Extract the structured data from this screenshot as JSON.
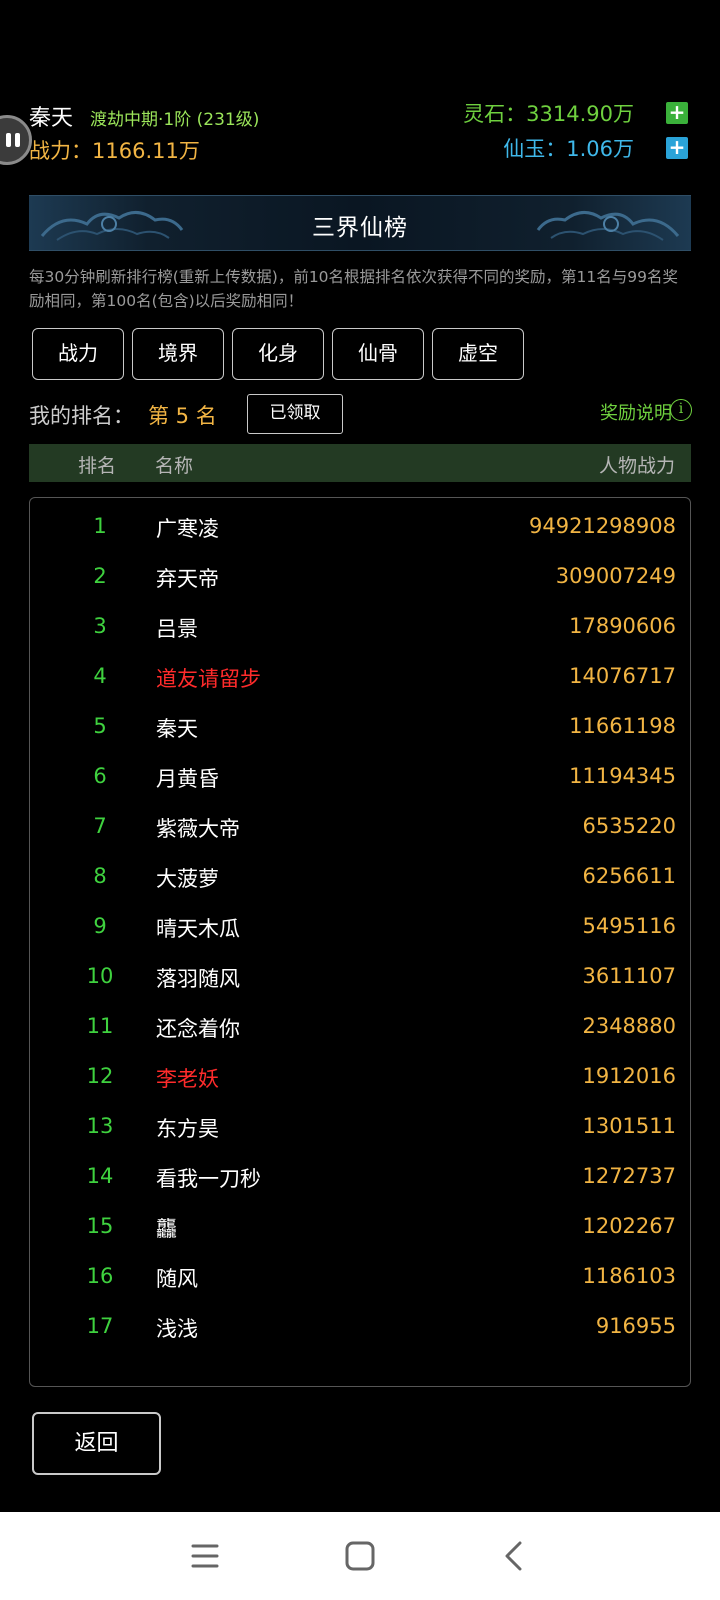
{
  "player": {
    "name": "秦天",
    "realm": "渡劫中期·1阶 (231级)",
    "power_label": "战力：1166.11万"
  },
  "currency": {
    "lingshi": "灵石：3314.90万",
    "xianyu": "仙玉：1.06万",
    "plus_symbol": "+"
  },
  "banner": {
    "title": "三界仙榜"
  },
  "description": "每30分钟刷新排行榜(重新上传数据)，前10名根据排名依次获得不同的奖励，第11名与99名奖励相同，第100名(包含)以后奖励相同！",
  "tabs": [
    "战力",
    "境界",
    "化身",
    "仙骨",
    "虚空"
  ],
  "my_rank": {
    "label": "我的排名：",
    "value": "第 5 名",
    "claimed_button": "已领取",
    "reward_info": "奖励说明",
    "info_symbol": "i"
  },
  "table": {
    "headers": {
      "rank": "排名",
      "name": "名称",
      "power": "人物战力"
    },
    "rows": [
      {
        "rank": "1",
        "name": "广寒凌",
        "power": "94921298908",
        "highlight": false
      },
      {
        "rank": "2",
        "name": "弃天帝",
        "power": "309007249",
        "highlight": false
      },
      {
        "rank": "3",
        "name": "吕景",
        "power": "17890606",
        "highlight": false
      },
      {
        "rank": "4",
        "name": "道友请留步",
        "power": "14076717",
        "highlight": true
      },
      {
        "rank": "5",
        "name": "秦天",
        "power": "11661198",
        "highlight": false
      },
      {
        "rank": "6",
        "name": "月黄昏",
        "power": "11194345",
        "highlight": false
      },
      {
        "rank": "7",
        "name": "紫薇大帝",
        "power": "6535220",
        "highlight": false
      },
      {
        "rank": "8",
        "name": "大菠萝",
        "power": "6256611",
        "highlight": false
      },
      {
        "rank": "9",
        "name": "晴天木瓜",
        "power": "5495116",
        "highlight": false
      },
      {
        "rank": "10",
        "name": "落羽随风",
        "power": "3611107",
        "highlight": false
      },
      {
        "rank": "11",
        "name": "还念着你",
        "power": "2348880",
        "highlight": false
      },
      {
        "rank": "12",
        "name": "李老妖",
        "power": "1912016",
        "highlight": true
      },
      {
        "rank": "13",
        "name": "东方昊",
        "power": "1301511",
        "highlight": false
      },
      {
        "rank": "14",
        "name": "看我一刀秒",
        "power": "1272737",
        "highlight": false
      },
      {
        "rank": "15",
        "name": "龘",
        "power": "1202267",
        "highlight": false
      },
      {
        "rank": "16",
        "name": "随风",
        "power": "1186103",
        "highlight": false
      },
      {
        "rank": "17",
        "name": "浅浅",
        "power": "916955",
        "highlight": false
      }
    ]
  },
  "back_button": "返回",
  "colors": {
    "rank_green": "#3fd23f",
    "power_gold": "#f2b544",
    "highlight_red": "#ff2b2b",
    "header_green_bg": "#233a23"
  }
}
